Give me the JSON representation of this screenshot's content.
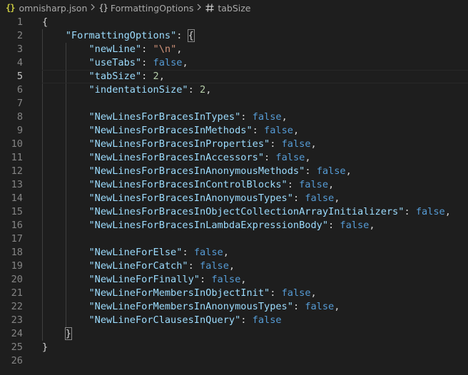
{
  "breadcrumb": {
    "icon_json": "{}",
    "file": "omnisharp.json",
    "icon_object": "{}",
    "object": "FormattingOptions",
    "property": "tabSize"
  },
  "editor": {
    "current_line": 5,
    "lines": [
      {
        "n": "1",
        "indent": 0,
        "open": "{"
      },
      {
        "n": "2",
        "indent": 1,
        "key": "\"FormattingOptions\"",
        "colon": ": ",
        "open_match": "{"
      },
      {
        "n": "3",
        "indent": 2,
        "key": "\"newLine\"",
        "colon": ": ",
        "str": "\"\\n\"",
        "comma": ","
      },
      {
        "n": "4",
        "indent": 2,
        "key": "\"useTabs\"",
        "colon": ": ",
        "bool": "false",
        "comma": ","
      },
      {
        "n": "5",
        "indent": 2,
        "key": "\"tabSize\"",
        "colon": ": ",
        "num": "2",
        "comma": ","
      },
      {
        "n": "6",
        "indent": 2,
        "key": "\"indentationSize\"",
        "colon": ": ",
        "num": "2",
        "comma": ","
      },
      {
        "n": "7",
        "indent": 2
      },
      {
        "n": "8",
        "indent": 2,
        "key": "\"NewLinesForBracesInTypes\"",
        "colon": ": ",
        "bool": "false",
        "comma": ","
      },
      {
        "n": "9",
        "indent": 2,
        "key": "\"NewLinesForBracesInMethods\"",
        "colon": ": ",
        "bool": "false",
        "comma": ","
      },
      {
        "n": "10",
        "indent": 2,
        "key": "\"NewLinesForBracesInProperties\"",
        "colon": ": ",
        "bool": "false",
        "comma": ","
      },
      {
        "n": "11",
        "indent": 2,
        "key": "\"NewLinesForBracesInAccessors\"",
        "colon": ": ",
        "bool": "false",
        "comma": ","
      },
      {
        "n": "12",
        "indent": 2,
        "key": "\"NewLinesForBracesInAnonymousMethods\"",
        "colon": ": ",
        "bool": "false",
        "comma": ","
      },
      {
        "n": "13",
        "indent": 2,
        "key": "\"NewLinesForBracesInControlBlocks\"",
        "colon": ": ",
        "bool": "false",
        "comma": ","
      },
      {
        "n": "14",
        "indent": 2,
        "key": "\"NewLinesForBracesInAnonymousTypes\"",
        "colon": ": ",
        "bool": "false",
        "comma": ","
      },
      {
        "n": "15",
        "indent": 2,
        "key": "\"NewLinesForBracesInObjectCollectionArrayInitializers\"",
        "colon": ": ",
        "bool": "false",
        "comma": ","
      },
      {
        "n": "16",
        "indent": 2,
        "key": "\"NewLinesForBracesInLambdaExpressionBody\"",
        "colon": ": ",
        "bool": "false",
        "comma": ","
      },
      {
        "n": "17",
        "indent": 2
      },
      {
        "n": "18",
        "indent": 2,
        "key": "\"NewLineForElse\"",
        "colon": ": ",
        "bool": "false",
        "comma": ","
      },
      {
        "n": "19",
        "indent": 2,
        "key": "\"NewLineForCatch\"",
        "colon": ": ",
        "bool": "false",
        "comma": ","
      },
      {
        "n": "20",
        "indent": 2,
        "key": "\"NewLineForFinally\"",
        "colon": ": ",
        "bool": "false",
        "comma": ","
      },
      {
        "n": "21",
        "indent": 2,
        "key": "\"NewLineForMembersInObjectInit\"",
        "colon": ": ",
        "bool": "false",
        "comma": ","
      },
      {
        "n": "22",
        "indent": 2,
        "key": "\"NewLineForMembersInAnonymousTypes\"",
        "colon": ": ",
        "bool": "false",
        "comma": ","
      },
      {
        "n": "23",
        "indent": 2,
        "key": "\"NewLineForClausesInQuery\"",
        "colon": ": ",
        "bool": "false"
      },
      {
        "n": "24",
        "indent": 1,
        "close_match": "}"
      },
      {
        "n": "25",
        "indent": 0,
        "close": "}"
      },
      {
        "n": "26",
        "indent": 0
      }
    ]
  },
  "colors": {
    "background": "#1e1e1e",
    "property_key": "#9cdcfe",
    "string_value": "#ce9178",
    "boolean_value": "#569cd6",
    "number_value": "#b5cea8",
    "punctuation": "#d4d4d4",
    "line_number": "#858585",
    "breadcrumb_json_icon": "#cbcb41"
  },
  "icons": {
    "file_icon": "json-braces-icon",
    "object_icon": "object-braces-icon",
    "property_icon": "hash-icon",
    "separator_icon": "chevron-right-icon"
  }
}
